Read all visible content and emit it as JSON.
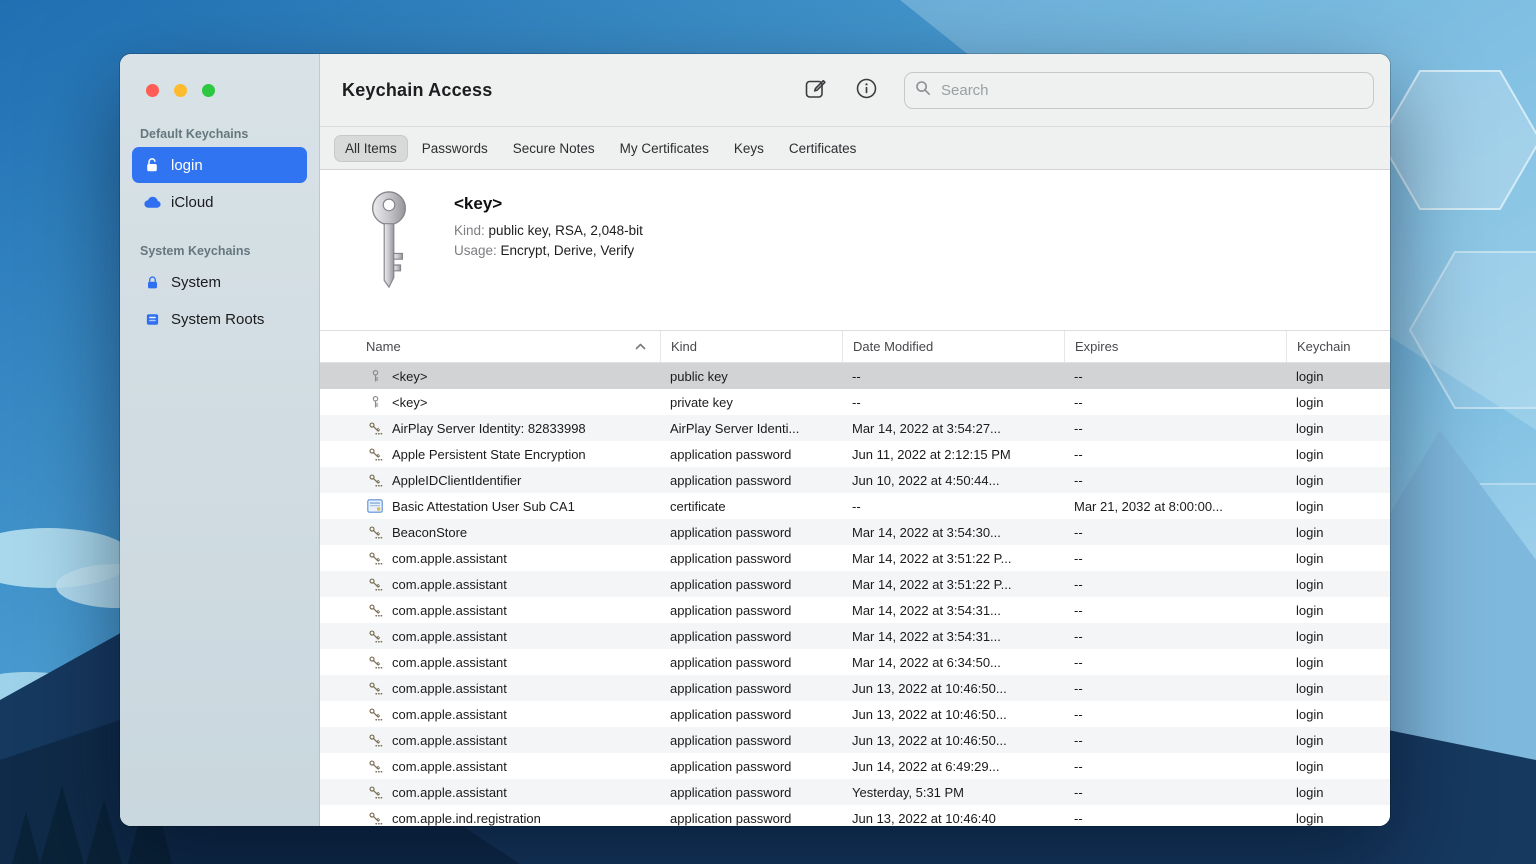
{
  "colors": {
    "accent": "#3174f1",
    "selection": "#d2d3d5",
    "stripe": "#f4f5f6",
    "traffic_red": "#ff5d55",
    "traffic_yellow": "#febb2e",
    "traffic_green": "#2bc840"
  },
  "window": {
    "title": "Keychain Access"
  },
  "toolbar": {
    "search_placeholder": "Search"
  },
  "sidebar": {
    "sections": [
      {
        "title": "Default Keychains",
        "items": [
          {
            "label": "login",
            "icon": "unlocked-padlock",
            "selected": true
          },
          {
            "label": "iCloud",
            "icon": "cloud",
            "selected": false
          }
        ]
      },
      {
        "title": "System Keychains",
        "items": [
          {
            "label": "System",
            "icon": "locked-padlock",
            "selected": false
          },
          {
            "label": "System Roots",
            "icon": "system-roots",
            "selected": false
          }
        ]
      }
    ]
  },
  "tabs": [
    {
      "label": "All Items",
      "selected": true
    },
    {
      "label": "Passwords",
      "selected": false
    },
    {
      "label": "Secure Notes",
      "selected": false
    },
    {
      "label": "My Certificates",
      "selected": false
    },
    {
      "label": "Keys",
      "selected": false
    },
    {
      "label": "Certificates",
      "selected": false
    }
  ],
  "detail": {
    "title": "<key>",
    "kind_label": "Kind:",
    "kind_value": "public key, RSA, 2,048-bit",
    "usage_label": "Usage:",
    "usage_value": "Encrypt, Derive, Verify"
  },
  "table": {
    "columns": [
      "Name",
      "Kind",
      "Date Modified",
      "Expires",
      "Keychain"
    ],
    "sort_column": "Name",
    "sort_direction": "ascending",
    "rows": [
      {
        "icon": "key",
        "name": "<key>",
        "kind": "public key",
        "date_modified": "--",
        "expires": "--",
        "keychain": "login",
        "selected": true
      },
      {
        "icon": "key",
        "name": "<key>",
        "kind": "private key",
        "date_modified": "--",
        "expires": "--",
        "keychain": "login",
        "selected": false
      },
      {
        "icon": "password",
        "name": "AirPlay Server Identity: 82833998",
        "kind": "AirPlay Server Identi...",
        "date_modified": "Mar 14, 2022 at 3:54:27...",
        "expires": "--",
        "keychain": "login",
        "selected": false
      },
      {
        "icon": "password",
        "name": "Apple Persistent State Encryption",
        "kind": "application password",
        "date_modified": "Jun 11, 2022 at 2:12:15 PM",
        "expires": "--",
        "keychain": "login",
        "selected": false
      },
      {
        "icon": "password",
        "name": "AppleIDClientIdentifier",
        "kind": "application password",
        "date_modified": "Jun 10, 2022 at 4:50:44...",
        "expires": "--",
        "keychain": "login",
        "selected": false
      },
      {
        "icon": "certificate",
        "name": "Basic Attestation User Sub CA1",
        "kind": "certificate",
        "date_modified": "--",
        "expires": "Mar 21, 2032 at 8:00:00...",
        "keychain": "login",
        "selected": false
      },
      {
        "icon": "password",
        "name": "BeaconStore",
        "kind": "application password",
        "date_modified": "Mar 14, 2022 at 3:54:30...",
        "expires": "--",
        "keychain": "login",
        "selected": false
      },
      {
        "icon": "password",
        "name": "com.apple.assistant",
        "kind": "application password",
        "date_modified": "Mar 14, 2022 at 3:51:22 P...",
        "expires": "--",
        "keychain": "login",
        "selected": false
      },
      {
        "icon": "password",
        "name": "com.apple.assistant",
        "kind": "application password",
        "date_modified": "Mar 14, 2022 at 3:51:22 P...",
        "expires": "--",
        "keychain": "login",
        "selected": false
      },
      {
        "icon": "password",
        "name": "com.apple.assistant",
        "kind": "application password",
        "date_modified": "Mar 14, 2022 at 3:54:31...",
        "expires": "--",
        "keychain": "login",
        "selected": false
      },
      {
        "icon": "password",
        "name": "com.apple.assistant",
        "kind": "application password",
        "date_modified": "Mar 14, 2022 at 3:54:31...",
        "expires": "--",
        "keychain": "login",
        "selected": false
      },
      {
        "icon": "password",
        "name": "com.apple.assistant",
        "kind": "application password",
        "date_modified": "Mar 14, 2022 at 6:34:50...",
        "expires": "--",
        "keychain": "login",
        "selected": false
      },
      {
        "icon": "password",
        "name": "com.apple.assistant",
        "kind": "application password",
        "date_modified": "Jun 13, 2022 at 10:46:50...",
        "expires": "--",
        "keychain": "login",
        "selected": false
      },
      {
        "icon": "password",
        "name": "com.apple.assistant",
        "kind": "application password",
        "date_modified": "Jun 13, 2022 at 10:46:50...",
        "expires": "--",
        "keychain": "login",
        "selected": false
      },
      {
        "icon": "password",
        "name": "com.apple.assistant",
        "kind": "application password",
        "date_modified": "Jun 13, 2022 at 10:46:50...",
        "expires": "--",
        "keychain": "login",
        "selected": false
      },
      {
        "icon": "password",
        "name": "com.apple.assistant",
        "kind": "application password",
        "date_modified": "Jun 14, 2022 at 6:49:29...",
        "expires": "--",
        "keychain": "login",
        "selected": false
      },
      {
        "icon": "password",
        "name": "com.apple.assistant",
        "kind": "application password",
        "date_modified": "Yesterday, 5:31 PM",
        "expires": "--",
        "keychain": "login",
        "selected": false
      },
      {
        "icon": "password",
        "name": "com.apple.ind.registration",
        "kind": "application password",
        "date_modified": "Jun 13, 2022 at 10:46:40",
        "expires": "--",
        "keychain": "login",
        "selected": false
      }
    ]
  }
}
